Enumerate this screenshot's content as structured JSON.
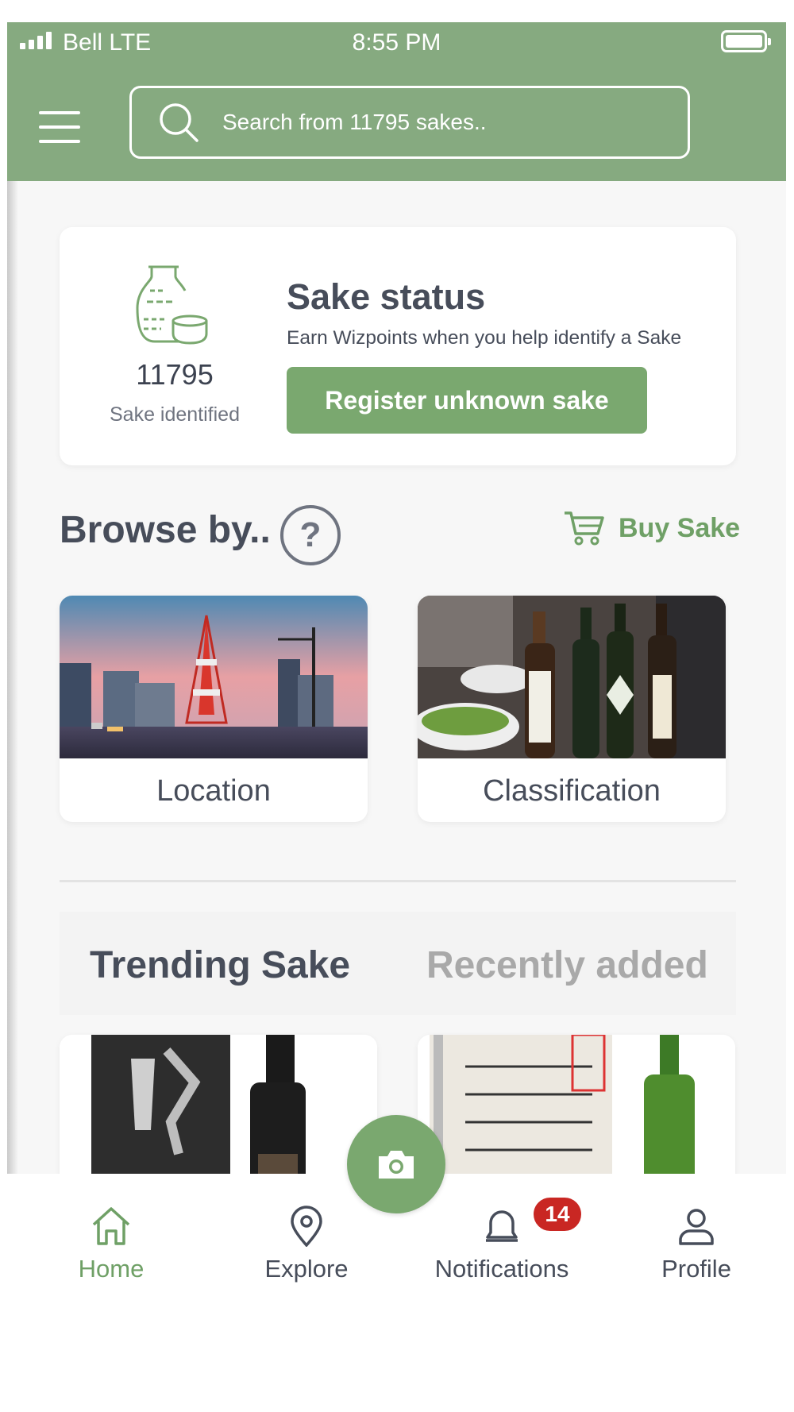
{
  "status_bar": {
    "carrier": "Bell LTE",
    "time": "8:55 PM"
  },
  "header": {
    "search_placeholder": "Search from 11795 sakes.."
  },
  "status_card": {
    "count": "11795",
    "count_label": "Sake identified",
    "title": "Sake status",
    "subtitle": "Earn Wizpoints when you help identify a Sake",
    "register_label": "Register unknown sake"
  },
  "browse": {
    "title": "Browse by..",
    "help": "?",
    "buy_label": "Buy Sake",
    "items": [
      {
        "label": "Location"
      },
      {
        "label": "Classification"
      }
    ]
  },
  "tabs": {
    "trending": "Trending Sake",
    "recent": "Recently added"
  },
  "bottom_nav": {
    "home": "Home",
    "explore": "Explore",
    "notifications": "Notifications",
    "notifications_badge": "14",
    "profile": "Profile"
  },
  "colors": {
    "brand_green": "#86aa80",
    "button_green": "#7aa86f",
    "text_dark": "#474d5a",
    "badge_red": "#c92723"
  }
}
